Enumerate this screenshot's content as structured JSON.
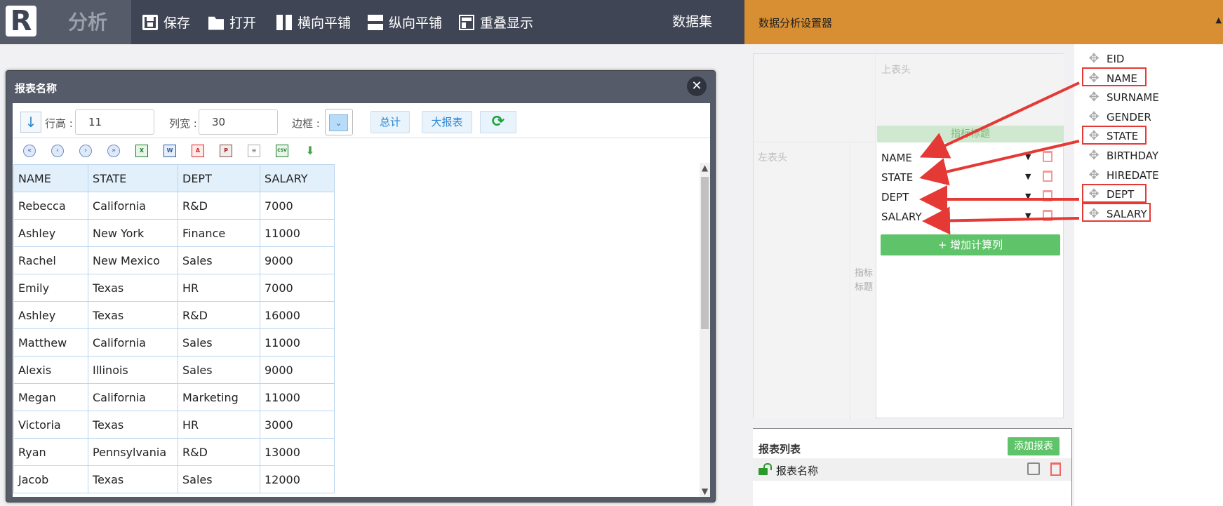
{
  "toolbar": {
    "logo_letter": "R",
    "app_title": "分析",
    "save_label": "保存",
    "open_label": "打开",
    "hsplit_label": "横向平铺",
    "vsplit_label": "纵向平铺",
    "overlap_label": "重叠显示",
    "dataset_label": "数据集"
  },
  "report_window": {
    "title": "报表名称",
    "close_symbol": "✕",
    "sort_symbol": "↓",
    "row_height_label": "行高 :",
    "row_height_value": "11",
    "col_width_label": "列宽 :",
    "col_width_value": "30",
    "border_label": "边框 :",
    "total_button": "总计",
    "big_report_button": "大报表",
    "refresh_symbol": "⟳",
    "table": {
      "headers": [
        "NAME",
        "STATE",
        "DEPT",
        "SALARY"
      ],
      "rows": [
        [
          "Rebecca",
          "California",
          "R&D",
          "7000"
        ],
        [
          "Ashley",
          "New York",
          "Finance",
          "11000"
        ],
        [
          "Rachel",
          "New Mexico",
          "Sales",
          "9000"
        ],
        [
          "Emily",
          "Texas",
          "HR",
          "7000"
        ],
        [
          "Ashley",
          "Texas",
          "R&D",
          "16000"
        ],
        [
          "Matthew",
          "California",
          "Sales",
          "11000"
        ],
        [
          "Alexis",
          "Illinois",
          "Sales",
          "9000"
        ],
        [
          "Megan",
          "California",
          "Marketing",
          "11000"
        ],
        [
          "Victoria",
          "Texas",
          "HR",
          "3000"
        ],
        [
          "Ryan",
          "Pennsylvania",
          "R&D",
          "13000"
        ],
        [
          "Jacob",
          "Texas",
          "Sales",
          "12000"
        ]
      ]
    }
  },
  "panel": {
    "title": "数据分析设置器",
    "top_header_placeholder": "上表头",
    "left_header_placeholder": "左表头",
    "indicator_title": "指标标题",
    "indicator_title_side": "指标 标题",
    "fields": [
      "NAME",
      "STATE",
      "DEPT",
      "SALARY"
    ],
    "add_calc_button": "+ 增加计算列",
    "report_list_title": "报表列表",
    "add_report_button": "添加报表",
    "report_item": "报表名称"
  },
  "field_list": [
    "EID",
    "NAME",
    "SURNAME",
    "GENDER",
    "STATE",
    "BIRTHDAY",
    "HIREDATE",
    "DEPT",
    "SALARY"
  ],
  "colors": {
    "topbar": "#3f4554",
    "panel_header": "#d88e32",
    "green_button": "#5fc36a",
    "highlight_red": "#e53935"
  }
}
